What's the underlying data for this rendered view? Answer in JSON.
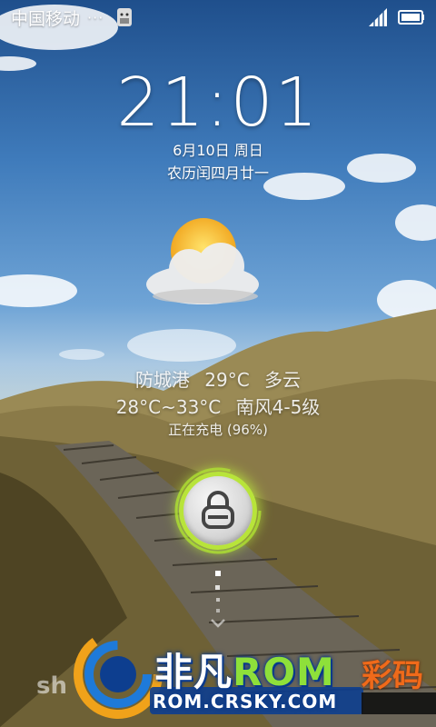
{
  "status_bar": {
    "carrier": "中国移动",
    "dots": "···",
    "icons": [
      "android-debug-icon",
      "signal-icon",
      "battery-icon"
    ]
  },
  "clock": {
    "time": "21:01",
    "date": "6月10日 周日",
    "lunar": "农历闰四月廿一"
  },
  "weather": {
    "icon": "partly-cloudy-icon",
    "line1": "防城港 29°C 多云",
    "line2": "28°C~33°C 南风4-5级",
    "charging": "正在充电 (96%)"
  },
  "unlock": {
    "icon": "lock-icon",
    "accent": "#b8e43a"
  },
  "watermark": {
    "name_cn": "非凡",
    "name_rom": "ROM",
    "url": "ROM.CRSKY.COM",
    "extra": "彩码",
    "left_partial": "sh"
  }
}
